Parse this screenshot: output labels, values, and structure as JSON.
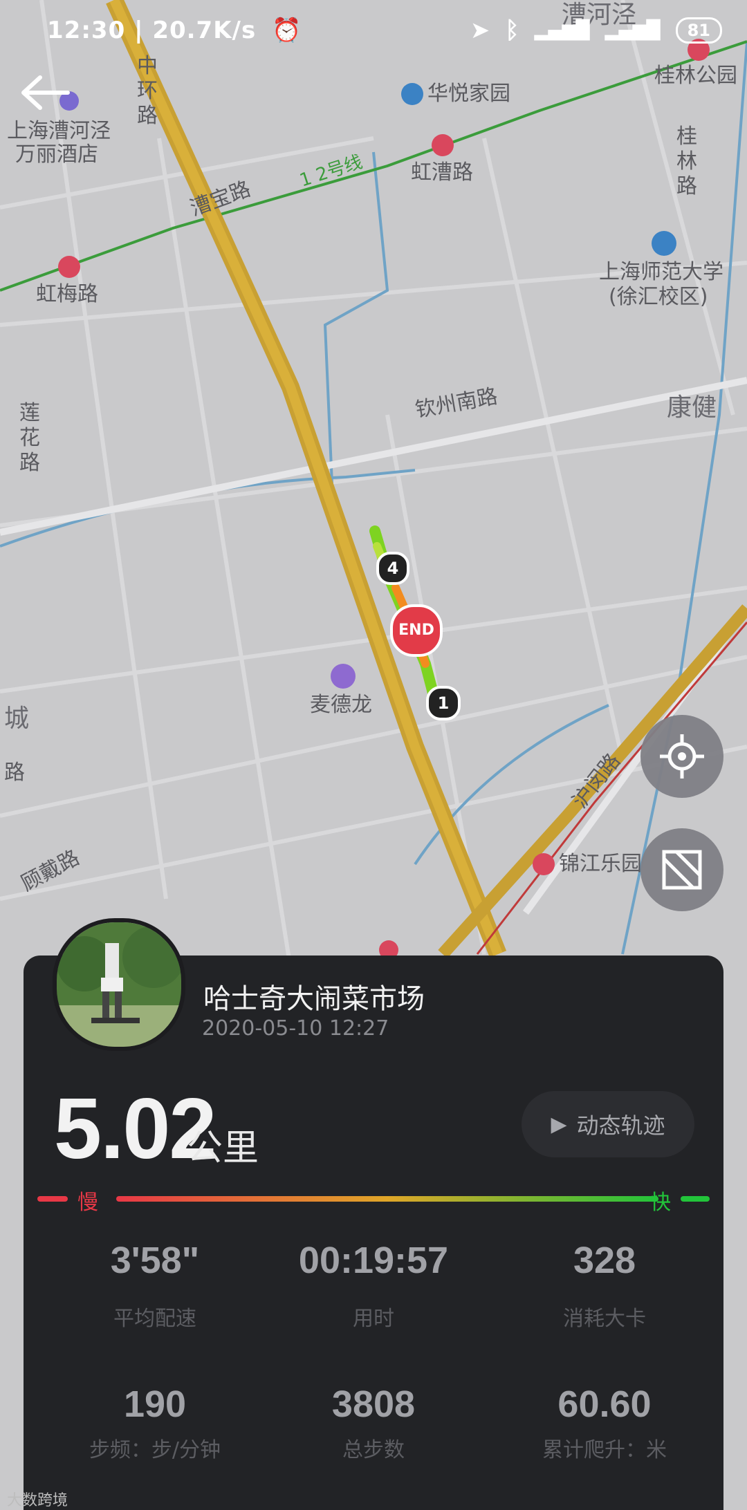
{
  "status_bar": {
    "time_speed": "12:30 | 20.7K/s",
    "battery": "81"
  },
  "map": {
    "labels": {
      "zhonghuan": "中环路",
      "caohejing": "漕河泾",
      "guilin_park": "桂林公园",
      "huayue": "华悦家园",
      "hotel_1": "上海漕河泾",
      "hotel_2": "万丽酒店",
      "caobao": "漕宝路",
      "line12": "1 2号线",
      "hongcao": "虹漕路",
      "guilin_rd": "桂林路",
      "hongmei": "虹梅路",
      "normal_univ_1": "上海师范大学",
      "normal_univ_2": "(徐汇校区)",
      "qinzhou": "钦州南路",
      "kangjian": "康健",
      "lianhua": "莲花路",
      "metro": "麦德龙",
      "cheng": "城",
      "lu": "路",
      "humin": "沪闵路",
      "jinjiang": "锦江乐园",
      "gudai": "顾戴路"
    },
    "markers": {
      "start": "1",
      "km4": "4",
      "end": "END"
    }
  },
  "card": {
    "title": "哈士奇大闹菜市场",
    "datetime": "2020-05-10 12:27",
    "distance": "5.02",
    "distance_unit": "公里",
    "replay_label": "动态轨迹",
    "slow_label": "慢",
    "fast_label": "快",
    "stats": [
      {
        "value": "3'58\"",
        "label": "平均配速"
      },
      {
        "value": "00:19:57",
        "label": "用时"
      },
      {
        "value": "328",
        "label": "消耗大卡"
      },
      {
        "value": "190",
        "label": "步频：步/分钟"
      },
      {
        "value": "3808",
        "label": "总步数"
      },
      {
        "value": "60.60",
        "label": "累计爬升：米"
      }
    ]
  },
  "watermark": "大数跨境",
  "colors": {
    "slow": "#e83846",
    "fast": "#22c43a",
    "card_bg": "#222326",
    "road_main": "#d4a52a"
  }
}
